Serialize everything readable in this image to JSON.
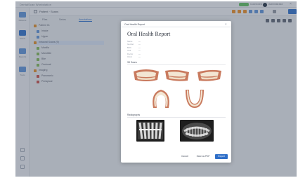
{
  "window": {
    "app_title": "DentalScan Workstation",
    "status_label": "Connected",
    "user_name": "Administrator"
  },
  "toolbar": {
    "path": "Patient · Scans"
  },
  "tabs": [
    {
      "label": "Files"
    },
    {
      "label": "Series"
    },
    {
      "label": "Annotations"
    }
  ],
  "rail": [
    {
      "label": "Patients"
    },
    {
      "label": "Scans"
    },
    {
      "label": "Reports"
    },
    {
      "label": "Tools"
    }
  ],
  "tree": [
    {
      "label": "Patient 01",
      "color": "#d98b2b"
    },
    {
      "label": "Intake",
      "color": "#5b8fd4"
    },
    {
      "label": "Upper",
      "color": "#5b8fd4"
    },
    {
      "label": "Intraoral Scans (9)",
      "color": "#d98b2b"
    },
    {
      "label": "Maxilla",
      "color": "#7db35a"
    },
    {
      "label": "Mandible",
      "color": "#7db35a"
    },
    {
      "label": "Bite",
      "color": "#7db35a"
    },
    {
      "label": "Occlusal",
      "color": "#7db35a"
    },
    {
      "label": "Imaging",
      "color": "#d98b2b"
    },
    {
      "label": "Panoramic",
      "color": "#c0504d"
    },
    {
      "label": "Periapical",
      "color": "#c0504d"
    }
  ],
  "modal": {
    "header": "Oral Health Report",
    "title": "Oral Health Report",
    "info": [
      {
        "key": "Name",
        "value": "—"
      },
      {
        "key": "Gender",
        "value": "—"
      },
      {
        "key": "Birth",
        "value": "—"
      },
      {
        "key": "Visit",
        "value": "—"
      },
      {
        "key": "Doctor",
        "value": "—"
      },
      {
        "key": "Clinic",
        "value": "—"
      }
    ],
    "section_scans": "3D Scans",
    "section_xray": "Radiographs",
    "buttons": {
      "cancel": "Cancel",
      "save": "Save as PDF",
      "export": "Export"
    }
  },
  "colors": {
    "accent": "#2f6fc8",
    "gum": "#c97a5e",
    "tooth": "#f3e6d3",
    "xray_bg": "#1e1e1e"
  },
  "icons": {
    "close": "close-icon",
    "status": "status-dot",
    "rail": "rail-icon"
  }
}
